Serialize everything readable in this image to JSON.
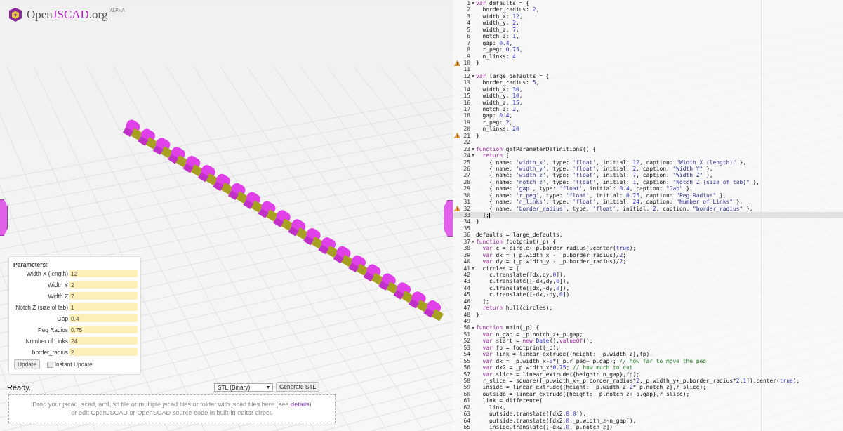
{
  "logo": {
    "prefix": "Open",
    "accent": "JSCAD",
    "suffix": ".org",
    "badge": "ALPHA"
  },
  "parameters": {
    "title": "Parameters:",
    "fields": [
      {
        "label": "Width X (length)",
        "value": "12"
      },
      {
        "label": "Width Y",
        "value": "2"
      },
      {
        "label": "Width Z",
        "value": "7"
      },
      {
        "label": "Notch Z (size of tab)",
        "value": "1"
      },
      {
        "label": "Gap",
        "value": "0.4"
      },
      {
        "label": "Peg Radius",
        "value": "0.75"
      },
      {
        "label": "Number of Links",
        "value": "24"
      },
      {
        "label": "border_radius",
        "value": "2"
      }
    ],
    "update_button": "Update",
    "instant_update": {
      "label": "Instant Update",
      "checked": false
    }
  },
  "status": "Ready.",
  "format_select": "STL (Binary)",
  "generate_button": "Generate STL",
  "drop_zone": {
    "line1": "Drop your jscad, scad, amf, stl file or multiple jscad files or folder with jscad files here (see ",
    "link": "details",
    "line1_end": ")",
    "line2": "or edit OpenJSCAD or OpenSCAD source-code in built-in editor direct."
  },
  "editor": {
    "lines": [
      {
        "n": "1",
        "text": "var defaults = {",
        "fold": true,
        "warning": false,
        "current": false
      },
      {
        "n": "2",
        "text": "  border_radius: 2,",
        "fold": false,
        "warning": false,
        "current": false
      },
      {
        "n": "3",
        "text": "  width_x: 12,",
        "fold": false,
        "warning": false,
        "current": false
      },
      {
        "n": "4",
        "text": "  width_y: 2,",
        "fold": false,
        "warning": false,
        "current": false
      },
      {
        "n": "5",
        "text": "  width_z: 7,",
        "fold": false,
        "warning": false,
        "current": false
      },
      {
        "n": "6",
        "text": "  notch_z: 1,",
        "fold": false,
        "warning": false,
        "current": false
      },
      {
        "n": "7",
        "text": "  gap: 0.4,",
        "fold": false,
        "warning": false,
        "current": false
      },
      {
        "n": "8",
        "text": "  r_peg: 0.75,",
        "fold": false,
        "warning": false,
        "current": false
      },
      {
        "n": "9",
        "text": "  n_links: 4",
        "fold": false,
        "warning": false,
        "current": false
      },
      {
        "n": "10",
        "text": "}",
        "fold": false,
        "warning": true,
        "current": false
      },
      {
        "n": "11",
        "fold": false,
        "warning": false,
        "current": false
      },
      {
        "n": "12",
        "text": "var large_defaults = {",
        "fold": true,
        "warning": false,
        "current": false
      },
      {
        "n": "13",
        "text": "  border_radius: 5,",
        "fold": false,
        "warning": false,
        "current": false
      },
      {
        "n": "14",
        "text": "  width_x: 30,",
        "fold": false,
        "warning": false,
        "current": false
      },
      {
        "n": "15",
        "text": "  width_y: 10,",
        "fold": false,
        "warning": false,
        "current": false
      },
      {
        "n": "16",
        "text": "  width_z: 15,",
        "fold": false,
        "warning": false,
        "current": false
      },
      {
        "n": "17",
        "text": "  notch_z: 2,",
        "fold": false,
        "warning": false,
        "current": false
      },
      {
        "n": "18",
        "text": "  gap: 0.4,",
        "fold": false,
        "warning": false,
        "current": false
      },
      {
        "n": "19",
        "text": "  r_peg: 2,",
        "fold": false,
        "warning": false,
        "current": false
      },
      {
        "n": "20",
        "text": "  n_links: 20",
        "fold": false,
        "warning": false,
        "current": false
      },
      {
        "n": "21",
        "text": "}",
        "fold": false,
        "warning": true,
        "current": false
      },
      {
        "n": "22",
        "fold": false,
        "warning": false,
        "current": false
      },
      {
        "n": "23",
        "text": "function getParameterDefinitions() {",
        "fold": true,
        "warning": false,
        "current": false
      },
      {
        "n": "24",
        "text": "  return [",
        "fold": true,
        "warning": false,
        "current": false
      },
      {
        "n": "25",
        "text": "    { name: 'width_x', type: 'float', initial: 12, caption: \"Width X (length)\" },",
        "fold": false,
        "warning": false,
        "current": false
      },
      {
        "n": "26",
        "text": "    { name: 'width_y', type: 'float', initial: 2, caption: \"Width Y\" },",
        "fold": false,
        "warning": false,
        "current": false
      },
      {
        "n": "27",
        "text": "    { name: 'width_z', type: 'float', initial: 7, caption: \"Width Z\" },",
        "fold": false,
        "warning": false,
        "current": false
      },
      {
        "n": "28",
        "text": "    { name: 'notch_z', type: 'float', initial: 1, caption: \"Notch Z (size of tab)\" },",
        "fold": false,
        "warning": false,
        "current": false
      },
      {
        "n": "29",
        "text": "    { name: 'gap', type: 'float', initial: 0.4, caption: \"Gap\" },",
        "fold": false,
        "warning": false,
        "current": false
      },
      {
        "n": "30",
        "text": "    { name: 'r_peg', type: 'float', initial: 0.75, caption: \"Peg Radius\" },",
        "fold": false,
        "warning": false,
        "current": false
      },
      {
        "n": "31",
        "text": "    { name: 'n_links', type: 'float', initial: 24, caption: \"Number of Links\" },",
        "fold": false,
        "warning": false,
        "current": false
      },
      {
        "n": "32",
        "text": "    { name: 'border_radius', type: 'float', initial: 2, caption: \"border_radius\" },",
        "fold": false,
        "warning": true,
        "current": false
      },
      {
        "n": "33",
        "text": "  ];",
        "fold": false,
        "warning": false,
        "current": true
      },
      {
        "n": "34",
        "text": "}",
        "fold": false,
        "warning": false,
        "current": false
      },
      {
        "n": "35",
        "fold": false,
        "warning": false,
        "current": false
      },
      {
        "n": "36",
        "text": "defaults = large_defaults;",
        "fold": false,
        "warning": false,
        "current": false
      },
      {
        "n": "37",
        "text": "function footprint(_p) {",
        "fold": true,
        "warning": false,
        "current": false
      },
      {
        "n": "38",
        "text": "  var c = circle(_p.border_radius).center(true);",
        "fold": false,
        "warning": false,
        "current": false
      },
      {
        "n": "39",
        "text": "  var dx = (_p.width_x - _p.border_radius)/2;",
        "fold": false,
        "warning": false,
        "current": false
      },
      {
        "n": "40",
        "text": "  var dy = (_p.width_y - _p.border_radius)/2;",
        "fold": false,
        "warning": false,
        "current": false
      },
      {
        "n": "41",
        "text": "  circles = [",
        "fold": true,
        "warning": false,
        "current": false
      },
      {
        "n": "42",
        "text": "    c.translate([dx,dy,0]),",
        "fold": false,
        "warning": false,
        "current": false
      },
      {
        "n": "43",
        "text": "    c.translate([-dx,dy,0]),",
        "fold": false,
        "warning": false,
        "current": false
      },
      {
        "n": "44",
        "text": "    c.translate([dx,-dy,0]),",
        "fold": false,
        "warning": false,
        "current": false
      },
      {
        "n": "45",
        "text": "    c.translate([-dx,-dy,0])",
        "fold": false,
        "warning": false,
        "current": false
      },
      {
        "n": "46",
        "text": "  ];",
        "fold": false,
        "warning": false,
        "current": false
      },
      {
        "n": "47",
        "text": "  return hull(circles);",
        "fold": false,
        "warning": false,
        "current": false
      },
      {
        "n": "48",
        "text": "}",
        "fold": false,
        "warning": false,
        "current": false
      },
      {
        "n": "49",
        "fold": false,
        "warning": false,
        "current": false
      },
      {
        "n": "50",
        "text": "function main(_p) {",
        "fold": true,
        "warning": false,
        "current": false
      },
      {
        "n": "51",
        "text": "  var n_gap = _p.notch_z+_p.gap;",
        "fold": false,
        "warning": false,
        "current": false
      },
      {
        "n": "52",
        "text": "  var start = new Date().valueOf();",
        "fold": false,
        "warning": false,
        "current": false
      },
      {
        "n": "53",
        "text": "  var fp = footprint(_p);",
        "fold": false,
        "warning": false,
        "current": false
      },
      {
        "n": "54",
        "text": "  var link = linear_extrude({height: _p.width_z},fp);",
        "fold": false,
        "warning": false,
        "current": false
      },
      {
        "n": "55",
        "text": "  var dx = _p.width_x-3*(_p.r_peg+_p.gap); // how far to move the peg",
        "fold": false,
        "warning": false,
        "current": false
      },
      {
        "n": "56",
        "text": "  var dx2 = _p.width_x*0.75; // how much to cut",
        "fold": false,
        "warning": false,
        "current": false
      },
      {
        "n": "57",
        "text": "  var slice = linear_extrude({height: n_gap},fp);",
        "fold": false,
        "warning": false,
        "current": false
      },
      {
        "n": "58",
        "text": "  r_slice = square([_p.width_x+_p.border_radius*2,_p.width_y+_p.border_radius*2,1]).center(true);",
        "fold": false,
        "warning": false,
        "current": false
      },
      {
        "n": "59",
        "text": "  inside = linear_extrude({height: _p.width_z-2*_p.notch_z},r_slice);",
        "fold": false,
        "warning": false,
        "current": false
      },
      {
        "n": "60",
        "text": "  outside = linear_extrude({height: _p.notch_z+_p.gap},r_slice);",
        "fold": false,
        "warning": false,
        "current": false
      },
      {
        "n": "61",
        "text": "  link = difference(",
        "fold": false,
        "warning": false,
        "current": false
      },
      {
        "n": "62",
        "text": "    link,",
        "fold": false,
        "warning": false,
        "current": false
      },
      {
        "n": "63",
        "text": "    outside.translate([dx2,0,0]),",
        "fold": false,
        "warning": false,
        "current": false
      },
      {
        "n": "64",
        "text": "    outside.translate([dx2,0,_p.width_z-n_gap]),",
        "fold": false,
        "warning": false,
        "current": false
      },
      {
        "n": "65",
        "text": "    inside.translate([-dx2,0,_p.notch_z])",
        "fold": false,
        "warning": false,
        "current": false
      }
    ]
  }
}
